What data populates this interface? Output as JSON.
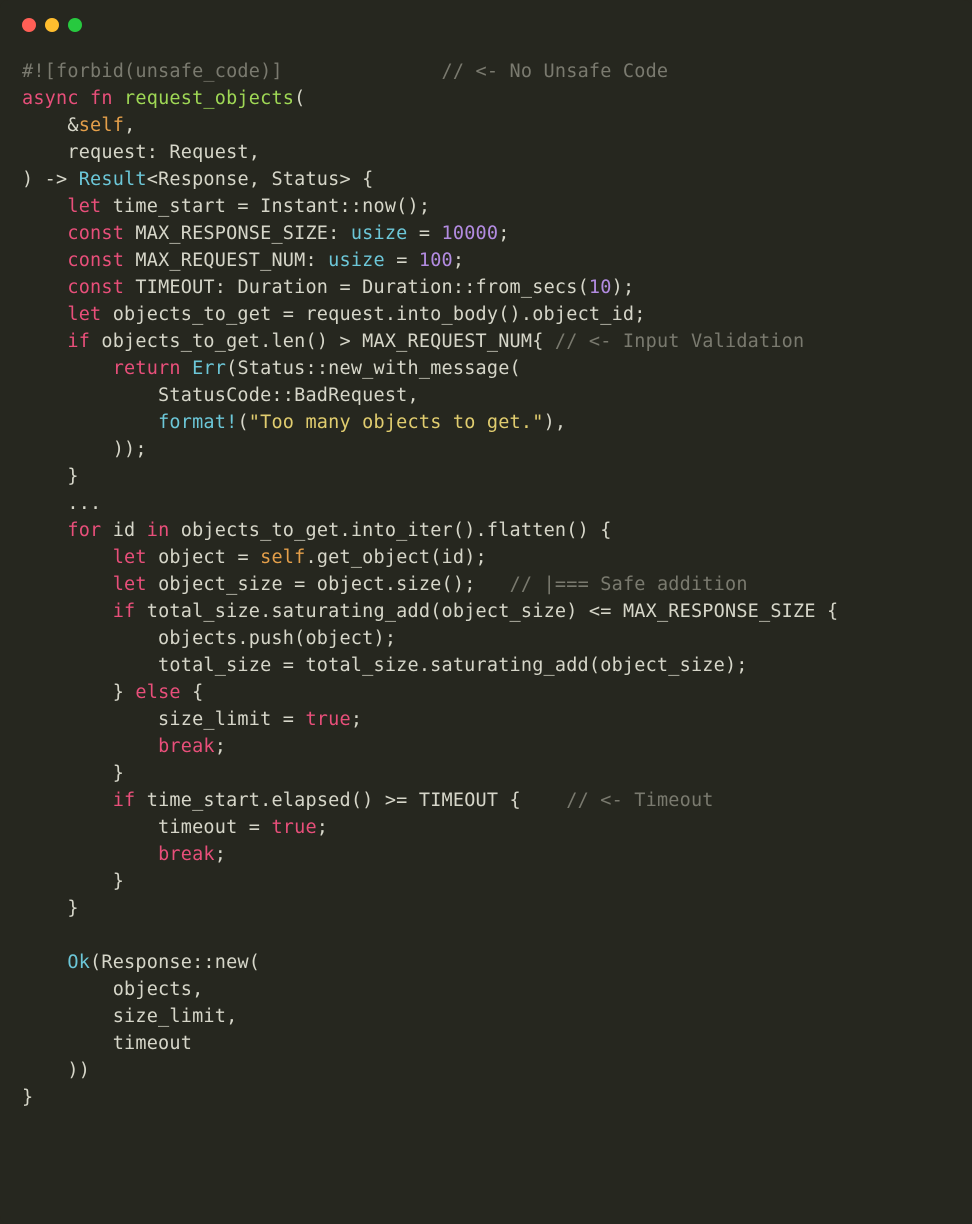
{
  "trafficLights": {
    "red": "#ff5f56",
    "yellow": "#ffbd2e",
    "green": "#27c93f"
  },
  "code": {
    "l1a": "#![forbid(unsafe_code)]              ",
    "l1b": "// <- No Unsafe Code",
    "l2a": "async",
    "l2b": " fn",
    "l2c": " request_objects",
    "l2d": "(",
    "l3a": "    &",
    "l3b": "self",
    "l3c": ",",
    "l4": "    request: Request,",
    "l5a": ") -> ",
    "l5b": "Result",
    "l5c": "<Response, Status> {",
    "l6a": "    ",
    "l6b": "let",
    "l6c": " time_start = Instant::now();",
    "l7a": "    ",
    "l7b": "const",
    "l7c": " MAX_RESPONSE_SIZE: ",
    "l7d": "usize",
    "l7e": " = ",
    "l7f": "10000",
    "l7g": ";",
    "l8a": "    ",
    "l8b": "const",
    "l8c": " MAX_REQUEST_NUM: ",
    "l8d": "usize",
    "l8e": " = ",
    "l8f": "100",
    "l8g": ";",
    "l9a": "    ",
    "l9b": "const",
    "l9c": " TIMEOUT: Duration = Duration::from_secs(",
    "l9d": "10",
    "l9e": ");",
    "l10a": "    ",
    "l10b": "let",
    "l10c": " objects_to_get = request.into_body().object_id;",
    "l11a": "    ",
    "l11b": "if",
    "l11c": " objects_to_get.len() > MAX_REQUEST_NUM{ ",
    "l11d": "// <- Input Validation",
    "l12a": "        ",
    "l12b": "return",
    "l12c": " ",
    "l12d": "Err",
    "l12e": "(Status::new_with_message(",
    "l13": "            StatusCode::BadRequest,",
    "l14a": "            ",
    "l14b": "format!",
    "l14c": "(",
    "l14d": "\"Too many objects to get.\"",
    "l14e": "),",
    "l15": "        ));",
    "l16": "    }",
    "l17": "    ...",
    "l18a": "    ",
    "l18b": "for",
    "l18c": " id ",
    "l18d": "in",
    "l18e": " objects_to_get.into_iter().flatten() {",
    "l19a": "        ",
    "l19b": "let",
    "l19c": " object = ",
    "l19d": "self",
    "l19e": ".get_object(id);",
    "l20a": "        ",
    "l20b": "let",
    "l20c": " object_size = object.size();   ",
    "l20d": "// |=== Safe addition",
    "l21a": "        ",
    "l21b": "if",
    "l21c": " total_size.saturating_add(object_size) <= MAX_RESPONSE_SIZE {",
    "l22": "            objects.push(object);",
    "l23": "            total_size = total_size.saturating_add(object_size);",
    "l24a": "        } ",
    "l24b": "else",
    "l24c": " {",
    "l25a": "            size_limit = ",
    "l25b": "true",
    "l25c": ";",
    "l26a": "            ",
    "l26b": "break",
    "l26c": ";",
    "l27": "        }",
    "l28a": "        ",
    "l28b": "if",
    "l28c": " time_start.elapsed() >= TIMEOUT {    ",
    "l28d": "// <- Timeout",
    "l29a": "            timeout = ",
    "l29b": "true",
    "l29c": ";",
    "l30a": "            ",
    "l30b": "break",
    "l30c": ";",
    "l31": "        }",
    "l32": "    }",
    "l33": "",
    "l34a": "    ",
    "l34b": "Ok",
    "l34c": "(Response::new(",
    "l35": "        objects,",
    "l36": "        size_limit,",
    "l37": "        timeout",
    "l38": "    ))",
    "l39": "}"
  }
}
